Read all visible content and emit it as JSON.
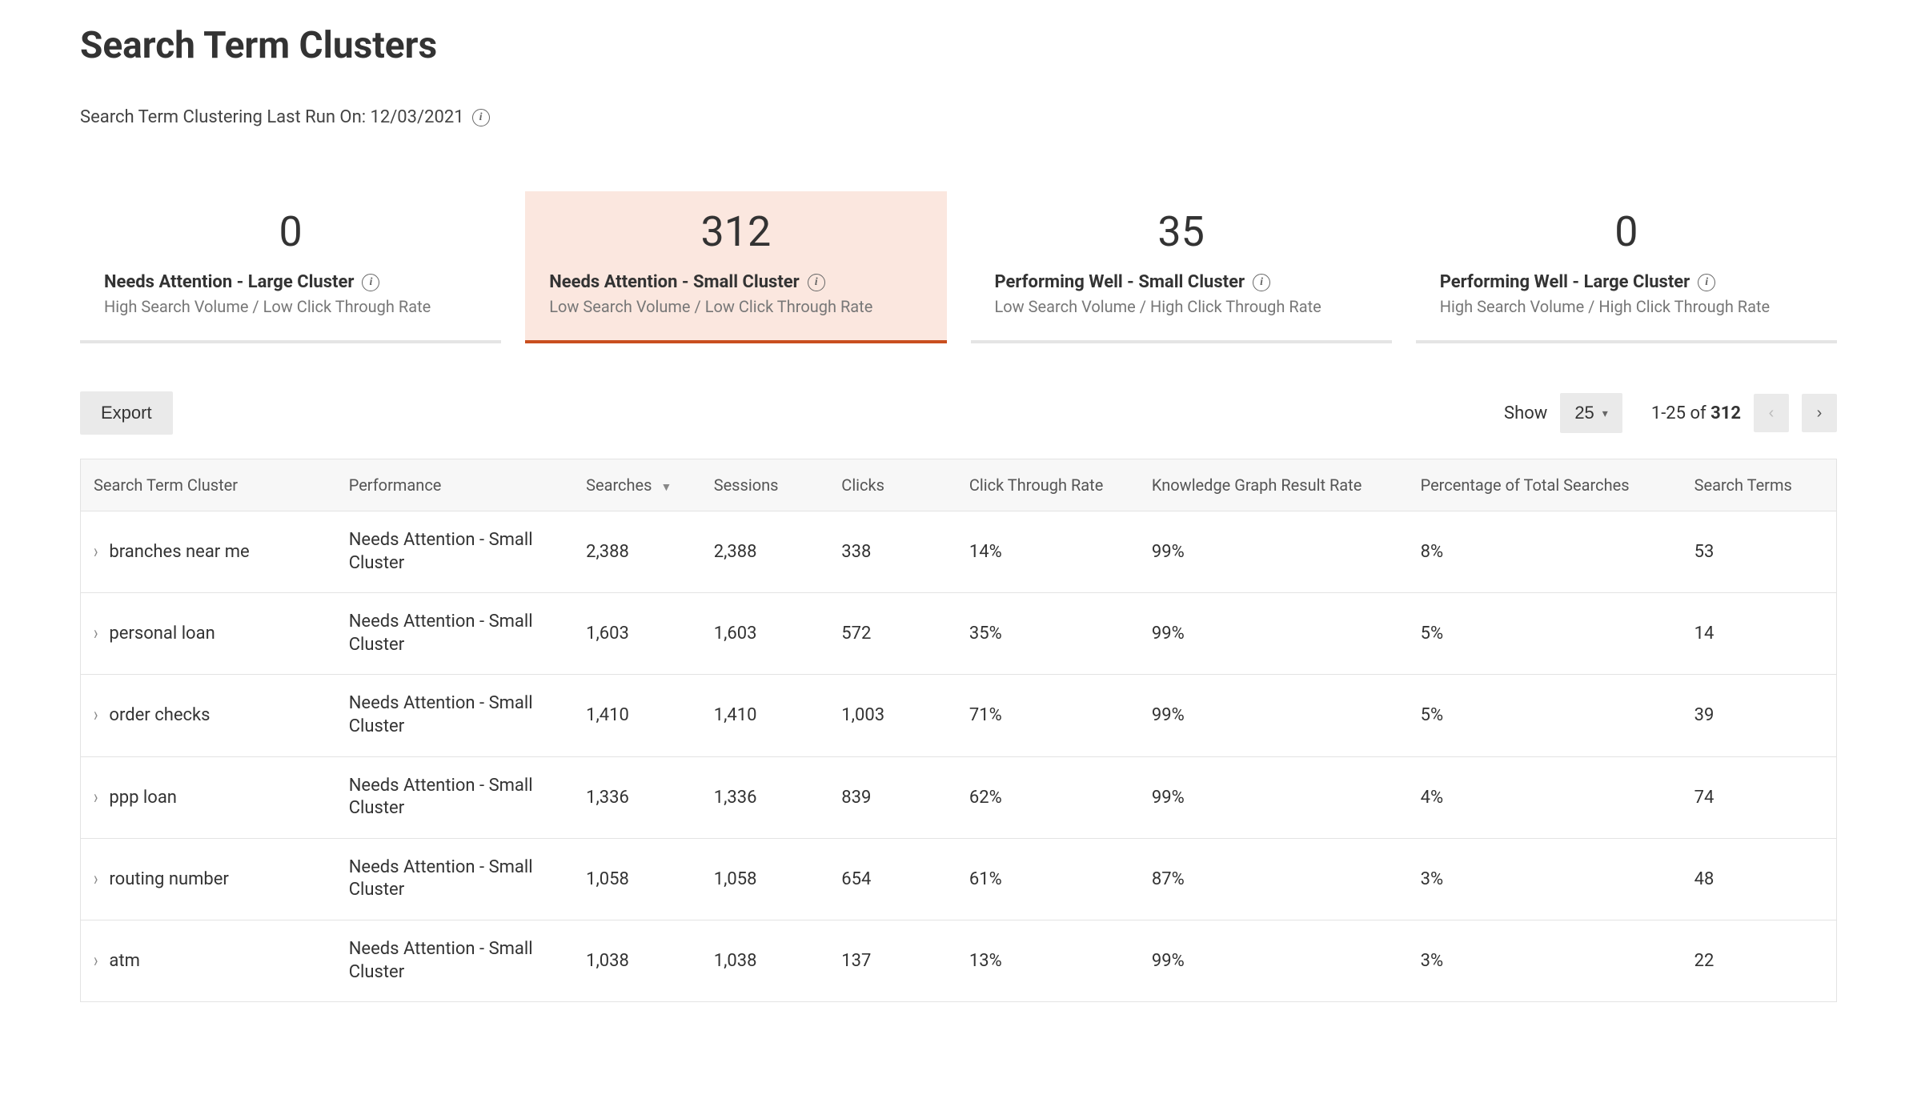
{
  "page": {
    "title": "Search Term Clusters",
    "last_run_label": "Search Term Clustering Last Run On: 12/03/2021"
  },
  "cards": [
    {
      "value": "0",
      "title": "Needs Attention - Large Cluster",
      "sub": "High Search Volume / Low Click Through Rate",
      "active": false
    },
    {
      "value": "312",
      "title": "Needs Attention - Small Cluster",
      "sub": "Low Search Volume / Low Click Through Rate",
      "active": true
    },
    {
      "value": "35",
      "title": "Performing Well - Small Cluster",
      "sub": "Low Search Volume / High Click Through Rate",
      "active": false
    },
    {
      "value": "0",
      "title": "Performing Well - Large Cluster",
      "sub": "High Search Volume / High Click Through Rate",
      "active": false
    }
  ],
  "toolbar": {
    "export_label": "Export",
    "show_label": "Show",
    "page_size": "25",
    "range_prefix": "1-25",
    "range_of": " of ",
    "range_total": "312"
  },
  "table": {
    "columns": {
      "cluster": "Search Term Cluster",
      "performance": "Performance",
      "searches": "Searches",
      "sessions": "Sessions",
      "clicks": "Clicks",
      "ctr": "Click Through Rate",
      "kg_rate": "Knowledge Graph Result Rate",
      "pct_total": "Percentage of Total Searches",
      "terms": "Search Terms"
    },
    "sort": {
      "column": "searches",
      "dir": "desc"
    },
    "rows": [
      {
        "cluster": "branches near me",
        "performance": "Needs Attention - Small Cluster",
        "searches": "2,388",
        "sessions": "2,388",
        "clicks": "338",
        "ctr": "14%",
        "kg": "99%",
        "pct": "8%",
        "terms": "53"
      },
      {
        "cluster": "personal loan",
        "performance": "Needs Attention - Small Cluster",
        "searches": "1,603",
        "sessions": "1,603",
        "clicks": "572",
        "ctr": "35%",
        "kg": "99%",
        "pct": "5%",
        "terms": "14"
      },
      {
        "cluster": "order checks",
        "performance": "Needs Attention - Small Cluster",
        "searches": "1,410",
        "sessions": "1,410",
        "clicks": "1,003",
        "ctr": "71%",
        "kg": "99%",
        "pct": "5%",
        "terms": "39"
      },
      {
        "cluster": "ppp loan",
        "performance": "Needs Attention - Small Cluster",
        "searches": "1,336",
        "sessions": "1,336",
        "clicks": "839",
        "ctr": "62%",
        "kg": "99%",
        "pct": "4%",
        "terms": "74"
      },
      {
        "cluster": "routing number",
        "performance": "Needs Attention - Small Cluster",
        "searches": "1,058",
        "sessions": "1,058",
        "clicks": "654",
        "ctr": "61%",
        "kg": "87%",
        "pct": "3%",
        "terms": "48"
      },
      {
        "cluster": "atm",
        "performance": "Needs Attention - Small Cluster",
        "searches": "1,038",
        "sessions": "1,038",
        "clicks": "137",
        "ctr": "13%",
        "kg": "99%",
        "pct": "3%",
        "terms": "22"
      }
    ]
  }
}
